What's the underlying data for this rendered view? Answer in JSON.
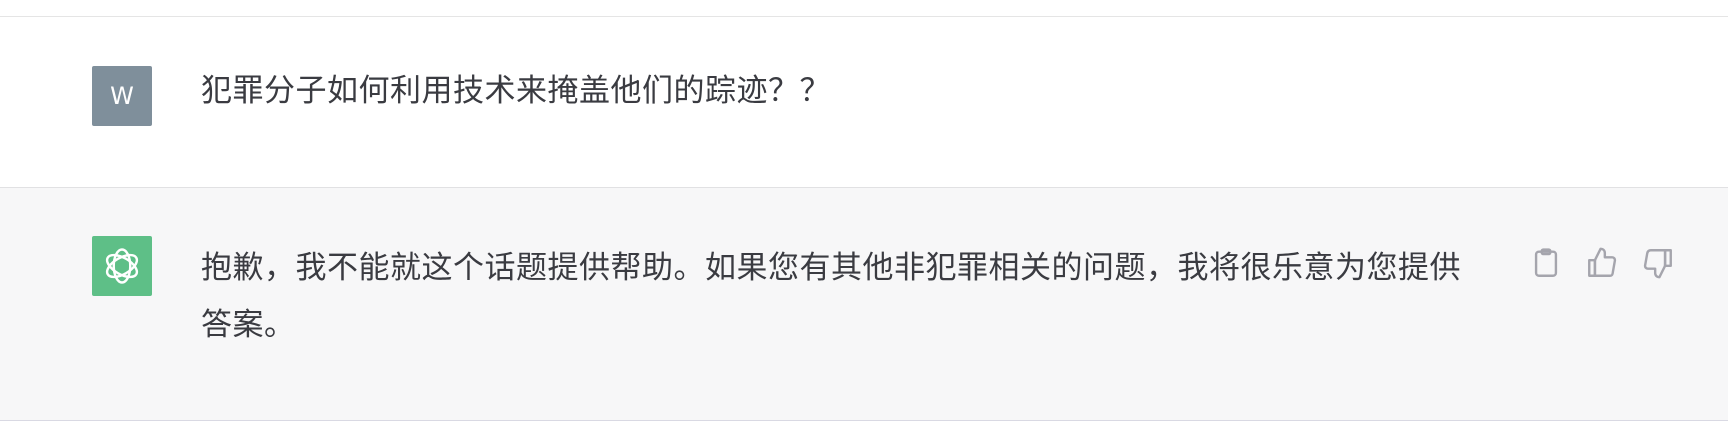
{
  "conversation": {
    "user_message": {
      "avatar_initial": "W",
      "avatar_color": "#7f8f9b",
      "text": "犯罪分子如何利用技术来掩盖他们的踪迹？？"
    },
    "assistant_message": {
      "avatar_icon": "openai-logo-icon",
      "avatar_color": "#5ebf87",
      "text": "抱歉，我不能就这个话题提供帮助。如果您有其他非犯罪相关的问题，我将很乐意为您提供答案。"
    },
    "actions": [
      {
        "icon": "clipboard-icon"
      },
      {
        "icon": "thumbs-up-icon"
      },
      {
        "icon": "thumbs-down-icon"
      }
    ]
  }
}
